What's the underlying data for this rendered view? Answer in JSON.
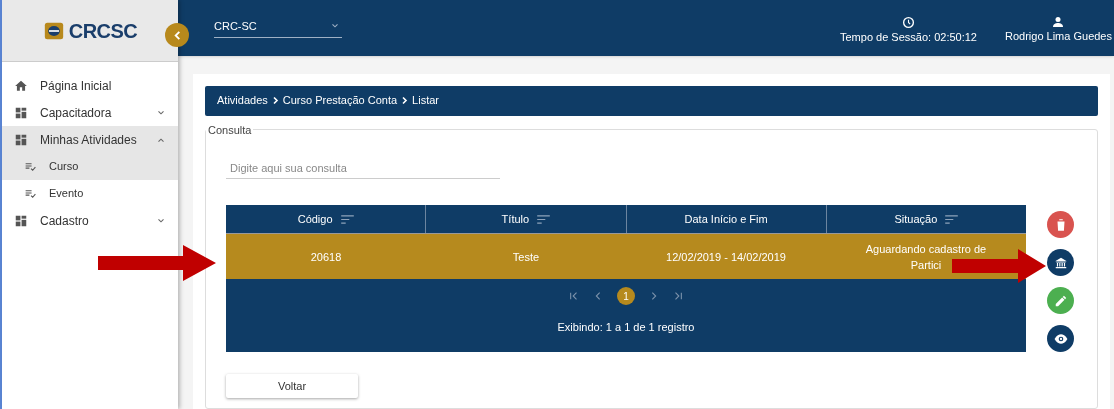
{
  "logo": {
    "name": "CRCSC"
  },
  "header": {
    "organization": "CRC-SC",
    "session": "Tempo de Sessão: 02:50:12",
    "user": "Rodrigo Lima Guedes"
  },
  "sidebar": {
    "items": [
      {
        "label": "Página Inicial",
        "kind": "home",
        "selected": false
      },
      {
        "label": "Capacitadora",
        "kind": "group",
        "selected": false,
        "expanded": false
      },
      {
        "label": "Minhas Atividades",
        "kind": "group",
        "selected": true,
        "expanded": true,
        "children": [
          {
            "label": "Curso",
            "selected": true
          },
          {
            "label": "Evento",
            "selected": false
          }
        ]
      },
      {
        "label": "Cadastro",
        "kind": "group",
        "selected": false,
        "expanded": false
      }
    ]
  },
  "breadcrumb": [
    "Atividades",
    "Curso Prestação Conta",
    "Listar"
  ],
  "consulta": {
    "legend": "Consulta",
    "placeholder": "Digite aqui sua consulta"
  },
  "table": {
    "columns": [
      {
        "label": "Código",
        "sortable": true
      },
      {
        "label": "Título",
        "sortable": true
      },
      {
        "label": "Data Início e Fim",
        "sortable": false
      },
      {
        "label": "Situação",
        "sortable": true
      }
    ],
    "rows": [
      {
        "selected": true,
        "cells": [
          "20618",
          "Teste",
          "12/02/2019 - 14/02/2019",
          "Aguardando cadastro de Partici"
        ]
      }
    ],
    "pages": [
      {
        "label": "1",
        "selected": true
      }
    ],
    "summary": "Exibindo: 1 a 1 de 1 registro"
  },
  "actions": [
    {
      "kind": "delete"
    },
    {
      "kind": "institution"
    },
    {
      "kind": "edit"
    },
    {
      "kind": "view"
    }
  ],
  "back_button": "Voltar"
}
